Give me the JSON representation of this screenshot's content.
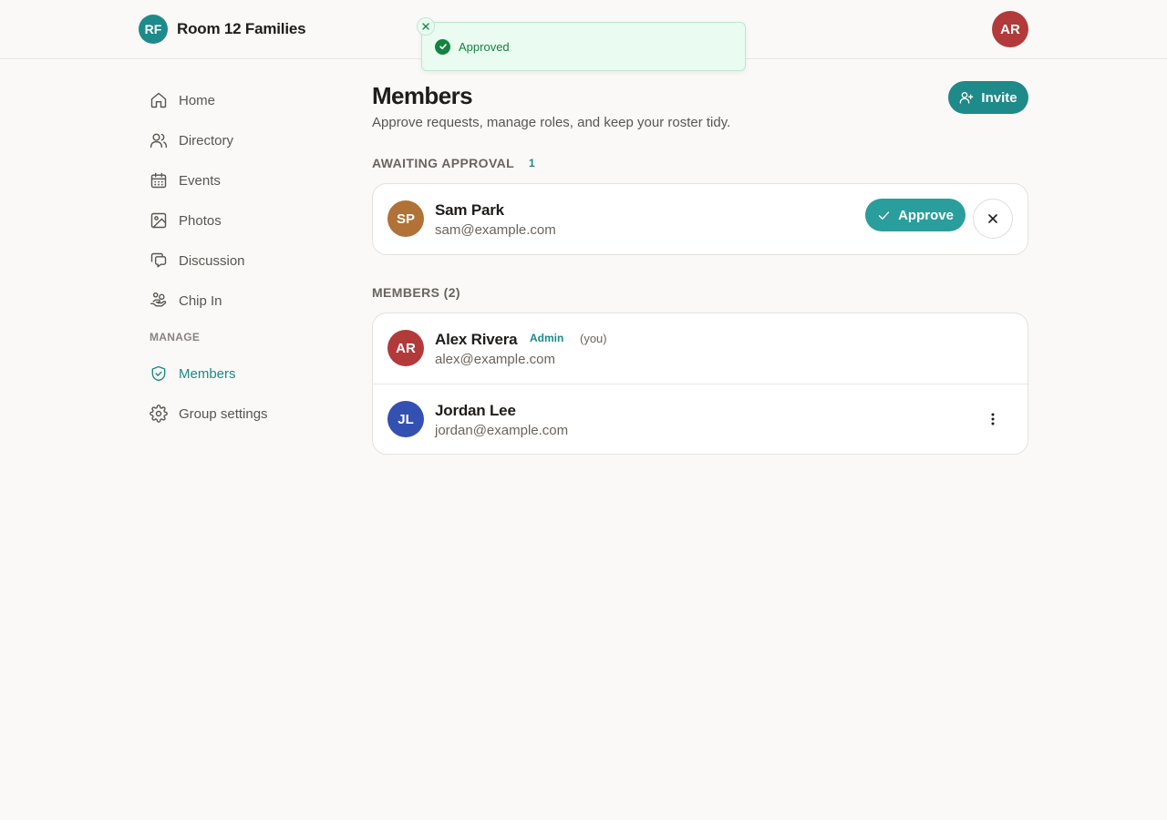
{
  "header": {
    "brand_initials": "RF",
    "brand_name": "Room 12 Families",
    "user_initials": "AR"
  },
  "toast": {
    "message": "Approved"
  },
  "sidebar": {
    "items": [
      {
        "label": "Home",
        "icon": "home-icon"
      },
      {
        "label": "Directory",
        "icon": "users-icon"
      },
      {
        "label": "Events",
        "icon": "calendar-icon"
      },
      {
        "label": "Photos",
        "icon": "image-icon"
      },
      {
        "label": "Discussion",
        "icon": "chat-icon"
      },
      {
        "label": "Chip In",
        "icon": "hand-coins-icon"
      }
    ],
    "section_label": "MANAGE",
    "manage_items": [
      {
        "label": "Members",
        "icon": "shield-check-icon",
        "active": true
      },
      {
        "label": "Group settings",
        "icon": "gear-icon",
        "active": false
      }
    ]
  },
  "main": {
    "title": "Members",
    "subtitle": "Approve requests, manage roles, and keep your roster tidy.",
    "invite_label": "Invite",
    "pending": {
      "label": "AWAITING APPROVAL",
      "count": "1",
      "items": [
        {
          "initials": "SP",
          "name": "Sam Park",
          "email": "sam@example.com",
          "avatar_color": "#b07236"
        }
      ],
      "approve_label": "Approve"
    },
    "members": {
      "label": "MEMBERS (2)",
      "items": [
        {
          "initials": "AR",
          "name": "Alex Rivera",
          "email": "alex@example.com",
          "role": "Admin",
          "you": "(you)",
          "avatar_color": "#b33a3a"
        },
        {
          "initials": "JL",
          "name": "Jordan Lee",
          "email": "jordan@example.com",
          "avatar_color": "#3451b2"
        }
      ]
    }
  },
  "colors": {
    "accent": "#1e8a8a",
    "success": "#13843f",
    "background": "#faf9f7"
  }
}
